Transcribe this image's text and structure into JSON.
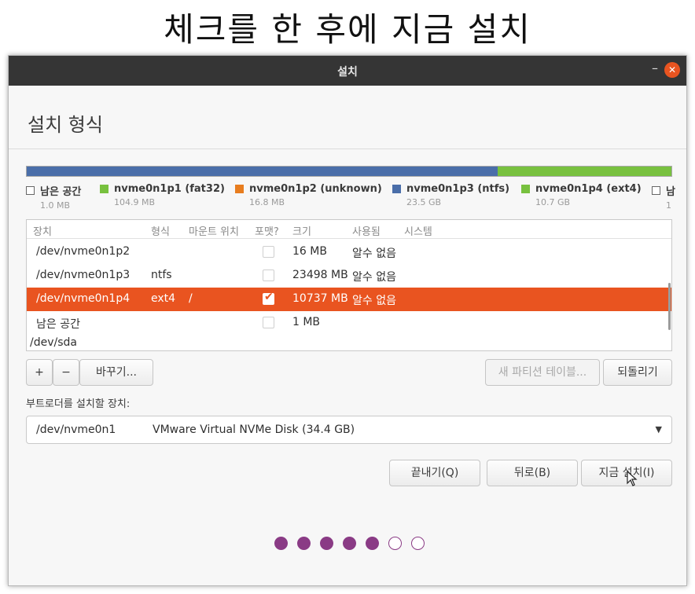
{
  "caption": "체크를 한 후에 지금 설치",
  "window": {
    "title": "설치",
    "minimize_glyph": "–",
    "close_glyph": "✕"
  },
  "page": {
    "heading": "설치 형식"
  },
  "disk_bar": {
    "segments": [
      {
        "name": "nvme0n1p3",
        "fraction": 0.73,
        "color": "#4a6ea9"
      },
      {
        "name": "nvme0n1p4",
        "fraction": 0.27,
        "color": "#78c13f"
      }
    ]
  },
  "legend": [
    {
      "label": "남은 공간",
      "size": "1.0 MB",
      "swatch": "empty"
    },
    {
      "label": "nvme0n1p1 (fat32)",
      "size": "104.9 MB",
      "swatch": "#78c13f"
    },
    {
      "label": "nvme0n1p2 (unknown)",
      "size": "16.8 MB",
      "swatch": "#e87d1f"
    },
    {
      "label": "nvme0n1p3 (ntfs)",
      "size": "23.5 GB",
      "swatch": "#4a6ea9"
    },
    {
      "label": "nvme0n1p4 (ext4)",
      "size": "10.7 GB",
      "swatch": "#78c13f"
    },
    {
      "label": "남",
      "size": "1",
      "swatch": "empty"
    }
  ],
  "table": {
    "headers": {
      "device": "장치",
      "type": "형식",
      "mount": "마운트 위치",
      "format": "포맷?",
      "size": "크기",
      "used": "사용됨",
      "system": "시스템"
    },
    "rows": [
      {
        "device": "/dev/nvme0n1p2",
        "type": "",
        "mount": "",
        "format": false,
        "size": "16 MB",
        "used": "알수 없음",
        "selected": false
      },
      {
        "device": "/dev/nvme0n1p3",
        "type": "ntfs",
        "mount": "",
        "format": false,
        "size": "23498 MB",
        "used": "알수 없음",
        "selected": false
      },
      {
        "device": "/dev/nvme0n1p4",
        "type": "ext4",
        "mount": "/",
        "format": true,
        "size": "10737 MB",
        "used": "알수 없음",
        "selected": true
      },
      {
        "device": "남은 공간",
        "type": "",
        "mount": "",
        "format": false,
        "size": "1 MB",
        "used": "",
        "selected": false
      }
    ],
    "disk_row": "/dev/sda",
    "check_glyph": "✔"
  },
  "toolbar": {
    "add_label": "+",
    "remove_label": "−",
    "change_label": "바꾸기...",
    "new_table_label": "새 파티션 테이블...",
    "revert_label": "되돌리기"
  },
  "bootloader": {
    "label": "부트로더를 설치할 장치:",
    "device": "/dev/nvme0n1",
    "description": "VMware Virtual NVMe Disk (34.4 GB)",
    "arrow_glyph": "▼"
  },
  "actions": {
    "quit_label": "끝내기(Q)",
    "back_label": "뒤로(B)",
    "install_label": "지금 설치(I)"
  },
  "progress": {
    "total_steps": 7,
    "completed_steps": 5,
    "active_color": "#8a3b85"
  }
}
